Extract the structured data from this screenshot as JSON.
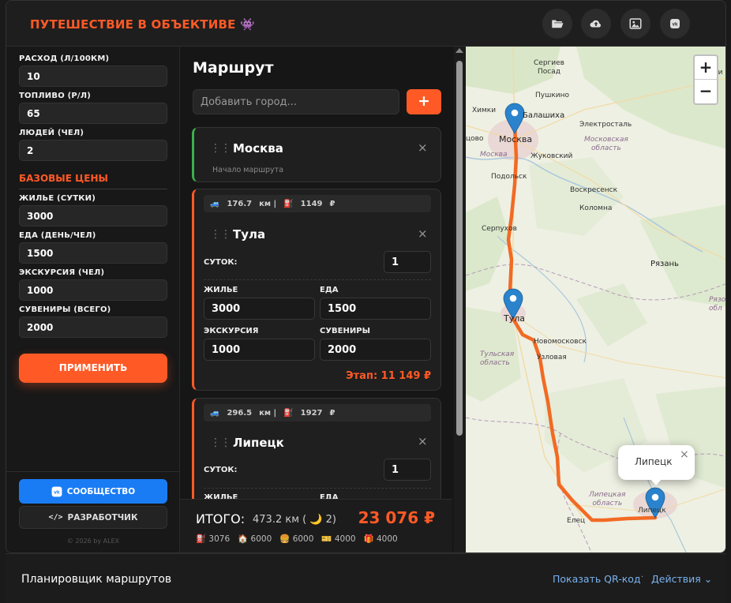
{
  "app": {
    "title": "ПУТЕШЕСТВИЕ В ОБЪЕКТИВЕ 👾",
    "header_icons": [
      "folder-open-icon",
      "cloud-upload-icon",
      "image-icon",
      "vk-icon"
    ]
  },
  "settings": {
    "consumption_label": "РАСХОД (Л/100КМ)",
    "consumption_value": "10",
    "fuel_label": "ТОПЛИВО (Р/Л)",
    "fuel_value": "65",
    "people_label": "ЛЮДЕЙ (ЧЕЛ)",
    "people_value": "2",
    "base_title": "БАЗОВЫЕ ЦЕНЫ",
    "housing_label": "ЖИЛЬЕ (СУТКИ)",
    "housing_value": "3000",
    "food_label": "ЕДА (ДЕНЬ/ЧЕЛ)",
    "food_value": "1500",
    "excursion_label": "ЭКСКУРСИЯ (ЧЕЛ)",
    "excursion_value": "1000",
    "souvenirs_label": "СУВЕНИРЫ (ВСЕГО)",
    "souvenirs_value": "2000",
    "apply_label": "ПРИМЕНИТЬ",
    "community_label": "СООБЩЕСТВО",
    "developer_label": "РАЗРАБОТЧИК",
    "copyright": "© 2026 by ALEX"
  },
  "route": {
    "title": "Маршрут",
    "add_placeholder": "Добавить город...",
    "add_button": "+",
    "start": {
      "name": "Москва",
      "subtitle": "Начало маршрута"
    },
    "stages": [
      {
        "distance": "176.7",
        "dist_unit": "км |",
        "fuel_cost": "1149",
        "currency": "₽",
        "name": "Тула",
        "days_label": "СУТОК:",
        "days": "1",
        "housing_label": "ЖИЛЬЕ",
        "housing": "3000",
        "food_label": "ЕДА",
        "food": "1500",
        "excursion_label": "ЭКСКУРСИЯ",
        "excursion": "1000",
        "souvenirs_label": "СУВЕНИРЫ",
        "souvenirs": "2000",
        "stage_total": "Этап: 11 149 ₽"
      },
      {
        "distance": "296.5",
        "dist_unit": "км |",
        "fuel_cost": "1927",
        "currency": "₽",
        "name": "Липецк",
        "days_label": "СУТОК:",
        "days": "1",
        "housing_label": "ЖИЛЬЕ",
        "food_label": "ЕДА"
      }
    ],
    "totals": {
      "label": "ИТОГО:",
      "distance": "473.2 км ( 🌙 2)",
      "sum": "23 076 ₽",
      "breakdown": [
        "⛽ 3076",
        "🏠 6000",
        "🍔 6000",
        "🎫 4000",
        "🎁 4000"
      ]
    }
  },
  "map": {
    "zoom_in": "+",
    "zoom_out": "−",
    "popup": "Липецк",
    "popup_close": "×",
    "labels": {
      "sergiev_posad": "Сергиев\nПосад",
      "pushkino": "Пушкино",
      "khimki": "Химки",
      "balashikha": "Балашиха",
      "elektrostal": "Электросталь",
      "moskva": "Москва",
      "moskovskaya_oblast": "Московская\nобласть",
      "moskva2": "Москва",
      "zhukovsky": "Жуковский",
      "podolsk": "Подольск",
      "voskresensk": "Воскресенск",
      "kolomna": "Коломна",
      "serpukhov": "Серпухов",
      "ryazan": "Рязань",
      "ryaz_obl": "Рязо\nобл",
      "tula": "Тула",
      "novomoskovsk": "Новомосковск",
      "tulskaya_oblast": "Тульская\nобласть",
      "uzlovaya": "Узловая",
      "lipetskaya_oblast": "Липецкая\nобласть",
      "lipetsk": "Липецк",
      "elets": "Елец",
      "vladimir_partial": "Влади",
      "odintsovo_partial": "цово"
    }
  },
  "footer": {
    "title": "Планировщик маршрутов",
    "qr_label": "Показать QR-код",
    "separator": "·",
    "actions_label": "Действия ⌄"
  }
}
